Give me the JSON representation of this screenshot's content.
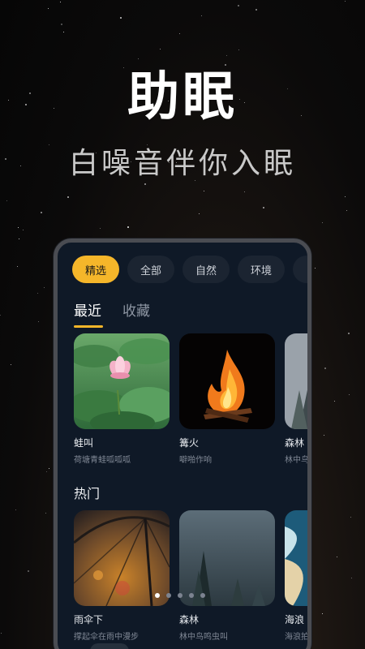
{
  "hero": {
    "title": "助眠",
    "subtitle": "白噪音伴你入眠"
  },
  "chips": [
    {
      "label": "精选",
      "active": true
    },
    {
      "label": "全部"
    },
    {
      "label": "自然"
    },
    {
      "label": "环境"
    }
  ],
  "tabs": [
    {
      "label": "最近",
      "active": true
    },
    {
      "label": "收藏"
    }
  ],
  "recent": [
    {
      "title": "蛙叫",
      "desc": "荷塘青蛙呱呱呱",
      "icon": "lotus"
    },
    {
      "title": "篝火",
      "desc": "噼啪作响",
      "icon": "fire"
    },
    {
      "title": "森林",
      "desc": "林中鸟",
      "icon": "forest"
    }
  ],
  "hot_title": "热门",
  "hot": [
    {
      "title": "雨伞下",
      "desc": "撑起伞在雨中漫步",
      "icon": "umbrella"
    },
    {
      "title": "森林",
      "desc": "林中鸟鸣虫叫",
      "icon": "forest"
    },
    {
      "title": "海浪",
      "desc": "海浪拍",
      "icon": "wave"
    }
  ],
  "accent_color": "#f5b62a",
  "pager": {
    "count": 5,
    "active": 0
  }
}
